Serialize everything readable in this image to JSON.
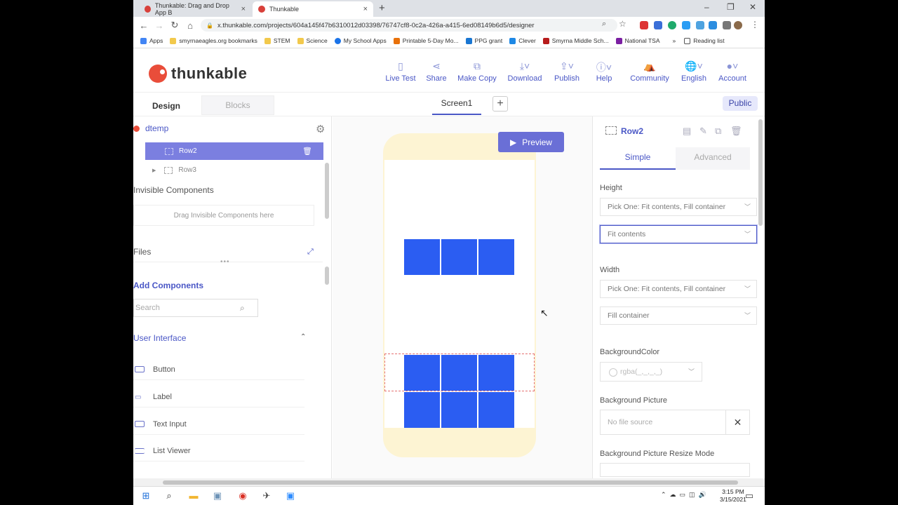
{
  "browser": {
    "tabs": [
      {
        "title": "Thunkable: Drag and Drop App B",
        "active": false
      },
      {
        "title": "Thunkable",
        "active": true
      }
    ],
    "url": "x.thunkable.com/projects/604a145f47b6310012d03398/76747cf8-0c2a-426a-a415-6ed08149b6d5/designer",
    "bookmarks": [
      "Apps",
      "smyrnaeagles.org bookmarks",
      "STEM",
      "Science",
      "My School Apps",
      "Printable 5-Day Mo...",
      "PPG grant",
      "Clever",
      "Smyrna Middle Sch...",
      "National TSA"
    ],
    "reading_list": "Reading list",
    "more_bookmarks": "»"
  },
  "header": {
    "logo_text": "thunkable",
    "buttons": [
      {
        "label": "Live Test",
        "icon": "phone-icon"
      },
      {
        "label": "Share",
        "icon": "share-icon"
      },
      {
        "label": "Make Copy",
        "icon": "copy-icon"
      },
      {
        "label": "Download",
        "icon": "download-icon"
      },
      {
        "label": "Publish",
        "icon": "publish-icon"
      },
      {
        "label": "Help",
        "icon": "help-icon"
      },
      {
        "label": "Community",
        "icon": "community-icon"
      },
      {
        "label": "English",
        "icon": "globe-icon"
      },
      {
        "label": "Account",
        "icon": "avatar-icon"
      }
    ]
  },
  "tabs": {
    "design": "Design",
    "blocks": "Blocks",
    "screen": "Screen1",
    "add": "+",
    "public": "Public"
  },
  "left": {
    "root": "dtemp",
    "tree": [
      {
        "label": "Row2",
        "selected": true
      },
      {
        "label": "Row3",
        "selected": false
      }
    ],
    "invisible_title": "Invisible Components",
    "invisible_drop": "Drag Invisible Components here",
    "files": "Files",
    "add_components": "Add Components",
    "search_placeholder": "Search",
    "ui_section": "User Interface",
    "components": [
      "Button",
      "Label",
      "Text Input",
      "List Viewer"
    ]
  },
  "canvas": {
    "preview": "Preview"
  },
  "right": {
    "component": "Row2",
    "tab_simple": "Simple",
    "tab_advanced": "Advanced",
    "height_label": "Height",
    "height_mode": "Pick One: Fit contents, Fill container",
    "height_value": "Fit contents",
    "width_label": "Width",
    "width_mode": "Pick One: Fit contents, Fill container",
    "width_value": "Fill container",
    "bgcolor_label": "BackgroundColor",
    "bgcolor_value": "rgba(_,_,_,_)",
    "bgpic_label": "Background Picture",
    "bgpic_value": "No file source",
    "bgresize_label": "Background Picture Resize Mode"
  },
  "taskbar": {
    "time": "3:15 PM",
    "date": "3/15/2021"
  },
  "colors": {
    "accent": "#4a57c6",
    "selected_row": "#7b7fe0",
    "cell": "#2b5df2",
    "phone": "#fdf4d3"
  }
}
